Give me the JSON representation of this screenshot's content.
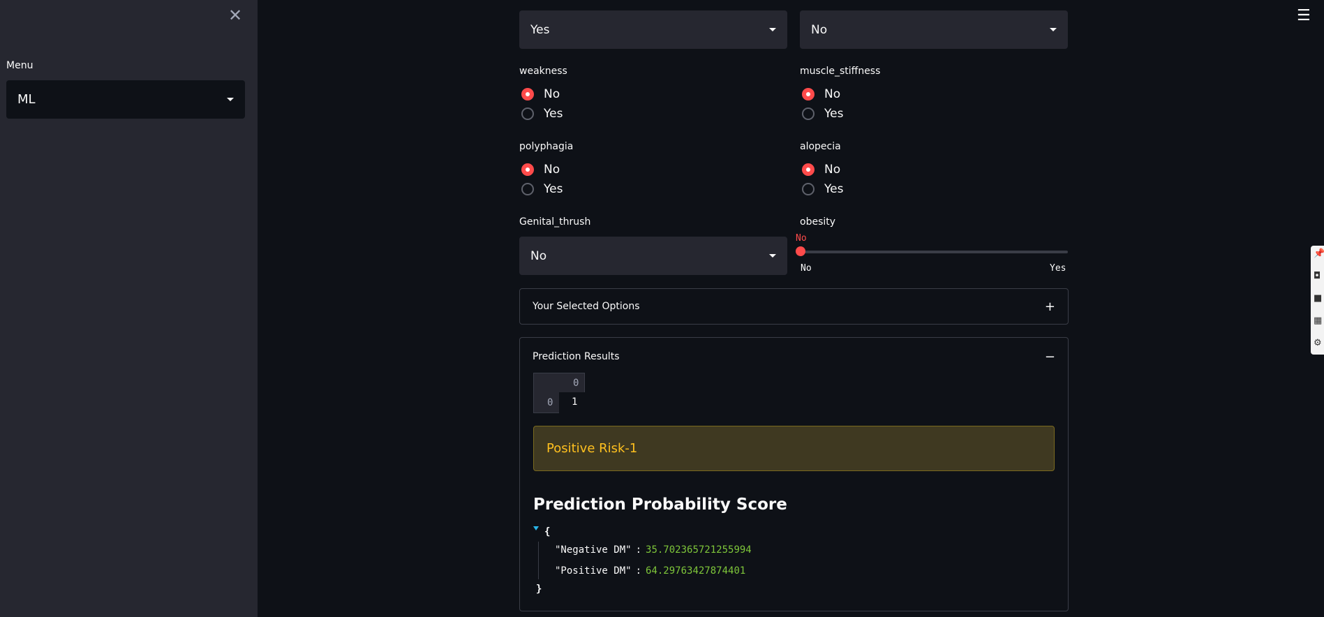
{
  "sidebar": {
    "menu_label": "Menu",
    "menu_selected": "ML"
  },
  "form": {
    "top_left_select": "Yes",
    "top_right_select": "No",
    "weakness": {
      "label": "weakness",
      "options": [
        "No",
        "Yes"
      ],
      "selected": "No"
    },
    "muscle_stiffness": {
      "label": "muscle_stiffness",
      "options": [
        "No",
        "Yes"
      ],
      "selected": "No"
    },
    "polyphagia": {
      "label": "polyphagia",
      "options": [
        "No",
        "Yes"
      ],
      "selected": "No"
    },
    "alopecia": {
      "label": "alopecia",
      "options": [
        "No",
        "Yes"
      ],
      "selected": "No"
    },
    "genital_thrush": {
      "label": "Genital_thrush",
      "selected": "No"
    },
    "obesity": {
      "label": "obesity",
      "value": "No",
      "min": "No",
      "max": "Yes",
      "fraction": 0.0
    }
  },
  "selected_options": {
    "title": "Your Selected Options",
    "toggle": "+"
  },
  "prediction": {
    "title": "Prediction Results",
    "toggle": "−",
    "table": {
      "column": "0",
      "index": "0",
      "value": "1"
    },
    "alert": "Positive Risk-1",
    "score_title": "Prediction Probability Score",
    "json_open": "{",
    "json_close": "}",
    "scores": [
      {
        "key": "\"Negative DM\"",
        "value": "35.702365721255994"
      },
      {
        "key": "\"Positive DM\"",
        "value": "64.29763427874401"
      }
    ]
  },
  "colors": {
    "accent": "#ff4b4b",
    "warning_text": "#ffc01f",
    "json_number": "#7ec63a"
  },
  "icons": [
    "close-icon",
    "chevron-down-icon",
    "hamburger-icon",
    "pin-icon",
    "camera-icon",
    "record-icon",
    "gallery-icon",
    "settings-icon"
  ]
}
